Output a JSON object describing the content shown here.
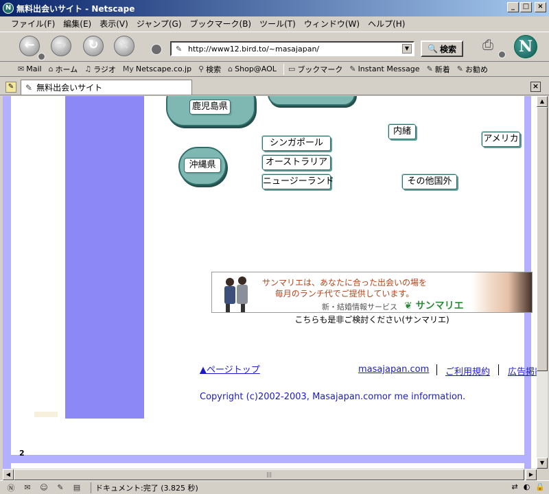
{
  "window": {
    "title": "無料出会いサイト - Netscape",
    "buttons": {
      "minimize": "_",
      "maximize": "□",
      "close": "×"
    }
  },
  "menu": [
    "ファイル(F)",
    "編集(E)",
    "表示(V)",
    "ジャンプ(G)",
    "ブックマーク(B)",
    "ツール(T)",
    "ウィンドウ(W)",
    "ヘルプ(H)"
  ],
  "nav": {
    "url": "http://www12.bird.to/~masajapan/",
    "search_label": "検索"
  },
  "personal_toolbar": [
    {
      "icon": "mail-icon",
      "label": "Mail"
    },
    {
      "icon": "home-icon",
      "label": "ホーム"
    },
    {
      "icon": "radio-icon",
      "label": "ラジオ"
    },
    {
      "icon": "my-netscape-icon",
      "label": "Netscape.co.jp"
    },
    {
      "icon": "search-icon",
      "label": "検索"
    },
    {
      "icon": "shop-icon",
      "label": "Shop@AOL"
    },
    {
      "icon": "bookmark-icon",
      "label": "ブックマーク"
    },
    {
      "icon": "bookmark-icon",
      "label": "Instant Message"
    },
    {
      "icon": "bookmark-icon",
      "label": "新着"
    },
    {
      "icon": "bookmark-icon",
      "label": "お勧め"
    }
  ],
  "personal_toolbar_icons": {
    "my": "My"
  },
  "tab": {
    "title": "無料出会いサイト"
  },
  "page": {
    "regions": {
      "kagoshima": "鹿児島県",
      "okinawa": "沖縄県",
      "singapore": "シンガポール",
      "australia": "オーストラリア",
      "newzealand": "ニュージーランド",
      "naisho": "内緒",
      "america": "アメリカ",
      "other": "その他国外"
    },
    "banner": {
      "line1": "サンマリエは、あなたに合った出会いの場を",
      "line2": "毎月のランチ代でご提供しています。",
      "service": "新・結婚情報サービス",
      "brand": "サンマリエ",
      "caption": "こちらも是非ご検討ください(サンマリエ)"
    },
    "footer": {
      "page_top": "▲ページトップ",
      "site_link": "masajapan.com",
      "terms": "ご利用規約",
      "ads": "広告掲載"
    },
    "copyright": "Copyright (c)2002-2003, Masajapan.comor me information.",
    "page_number": "2"
  },
  "status": {
    "text": "ドキュメント:完了 (3.825 秒)"
  }
}
